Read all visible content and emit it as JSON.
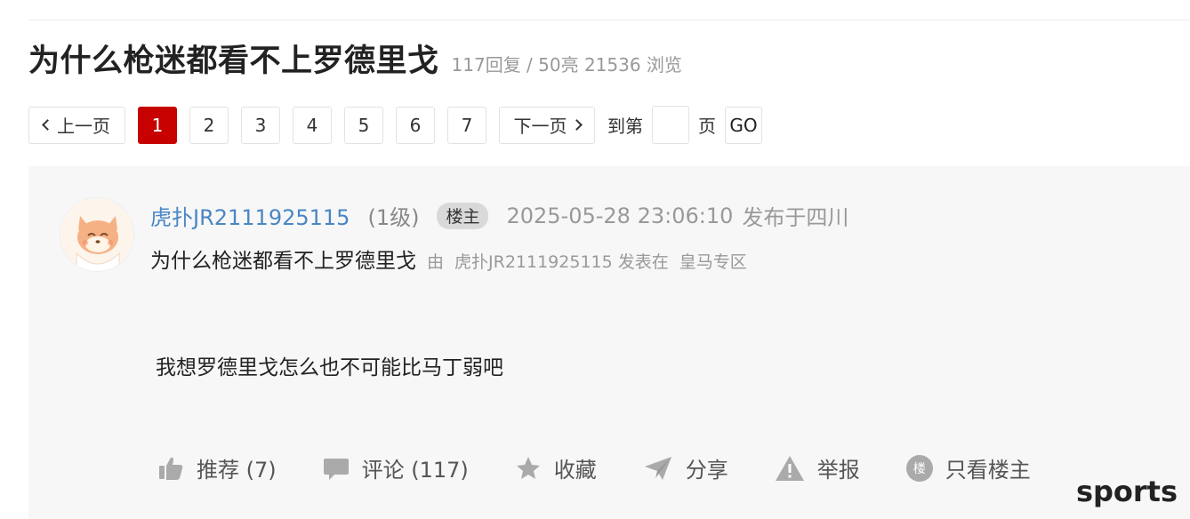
{
  "thread": {
    "title": "为什么枪迷都看不上罗德里戈",
    "stats": "117回复 / 50亮 21536 浏览"
  },
  "pagination": {
    "prev_label": "上一页",
    "pages": [
      "1",
      "2",
      "3",
      "4",
      "5",
      "6",
      "7"
    ],
    "current_page": "1",
    "next_label": "下一页",
    "goto_prefix": "到第",
    "goto_suffix": "页",
    "go_label": "GO"
  },
  "post": {
    "author": "虎扑JR2111925115",
    "level": "(1级)",
    "owner_badge": "楼主",
    "time": "2025-05-28 23:06:10",
    "location": "发布于四川",
    "sub_title": "为什么枪迷都看不上罗德里戈",
    "sub_by": "由",
    "sub_author": "虎扑JR2111925115",
    "sub_posted_in": "发表在",
    "sub_zone": "皇马专区",
    "body": "我想罗德里戈怎么也不可能比马丁弱吧"
  },
  "actions": {
    "recommend": "推荐 (7)",
    "comment": "评论 (117)",
    "favorite": "收藏",
    "share": "分享",
    "report": "举报",
    "lz_icon_text": "楼",
    "only_owner": "只看楼主"
  },
  "icons": {
    "recommend": "thumbs-up-icon",
    "comment": "speech-bubble-icon",
    "favorite": "star-icon",
    "share": "paper-plane-icon",
    "report": "warning-triangle-icon",
    "only_owner": "floor-badge-icon"
  },
  "colors": {
    "accent": "#c60100",
    "link": "#4a86c5",
    "muted": "#999999",
    "card_bg": "#f7f7f7"
  },
  "watermark": "sports"
}
